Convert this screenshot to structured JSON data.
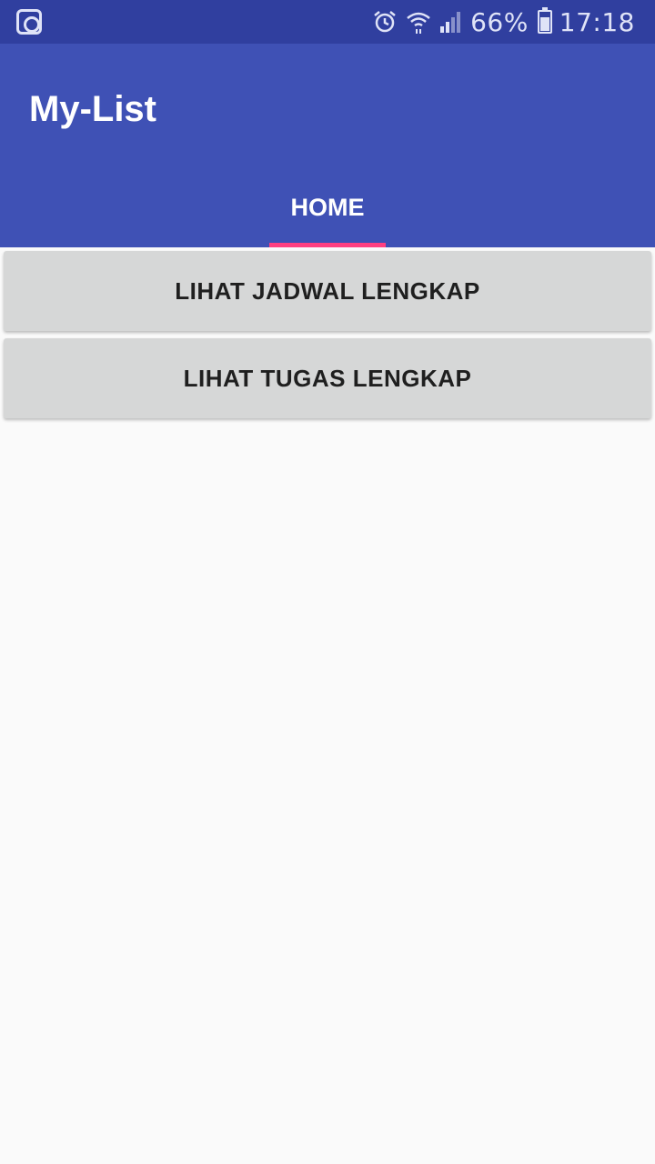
{
  "status_bar": {
    "left_icon": "media-notification-icon",
    "icons": [
      "alarm-icon",
      "wifi-icon",
      "signal-icon"
    ],
    "battery_percent": "66%",
    "battery_level": 0.66,
    "time": "17:18"
  },
  "toolbar": {
    "title": "My-List"
  },
  "tabs": [
    {
      "label": "HOME",
      "selected": true
    }
  ],
  "colors": {
    "status_bar": "#303f9f",
    "primary": "#3f51b5",
    "accent": "#ff4081",
    "button": "#d6d7d7",
    "background": "#fafafa"
  },
  "buttons": {
    "jadwal_label": "LIHAT JADWAL LENGKAP",
    "tugas_label": "LIHAT TUGAS LENGKAP"
  }
}
